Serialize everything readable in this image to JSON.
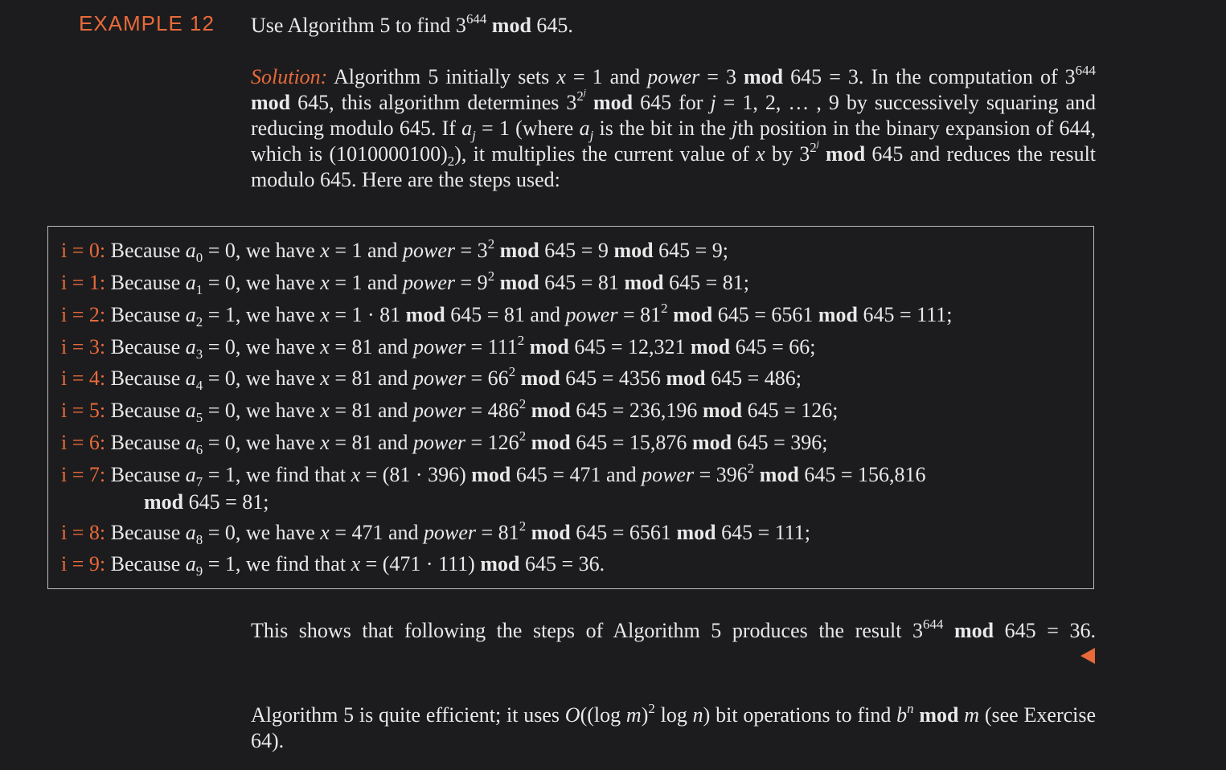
{
  "example": {
    "label": "EXAMPLE 12",
    "statement": {
      "pre": "Use Algorithm 5 to find 3",
      "exp": "644",
      "mod": "mod",
      "post": " 645."
    }
  },
  "solution": {
    "label": "Solution:",
    "t1": " Algorithm 5 initially sets ",
    "x": "x",
    "t2": " = 1 and ",
    "power": "power",
    "t3": " = 3 ",
    "mod": "mod",
    "t4": " 645 = 3. In the computation of 3",
    "exp644": "644",
    "t5": " 645, this algorithm determines 3",
    "exp2j": "2",
    "expj": "j",
    "t6": " 645 for ",
    "j": "j",
    "t7": " = 1, 2, … , 9 by successively squaring and reducing modulo 645. If ",
    "a": "a",
    "t8": " = 1 (where ",
    "t9": " is the bit in the ",
    "t10": "th position in the binary expansion of 644, which is (1010000100)",
    "base": "2",
    "t11": "), it multiplies the current value of ",
    "t12": " by 3",
    "t13": " 645 and reduces the result modulo 645. Here are the steps used:"
  },
  "steps": [
    {
      "idx": "i = 0:",
      "sub": "0",
      "pre": " = 0, we have ",
      "mid": " = 1 and ",
      "pw": " = 3",
      "e": "2",
      "t1": " 645 = 9 ",
      "t2": " 645 = 9;"
    },
    {
      "idx": "i = 1:",
      "sub": "1",
      "pre": " = 0, we have ",
      "mid": " = 1 and ",
      "pw": " = 9",
      "e": "2",
      "t1": " 645 = 81 ",
      "t2": " 645 = 81;"
    },
    {
      "idx": "i = 2:",
      "sub": "2",
      "pre": " = 1, we have ",
      "mid": " = 1 · 81 ",
      "mid2": " 645 = 81 and ",
      "pw": " = 81",
      "e": "2",
      "t1": " 645 = 6561 ",
      "t2": " 645 = 111;"
    },
    {
      "idx": "i = 3:",
      "sub": "3",
      "pre": " = 0, we have ",
      "mid": " = 81 and ",
      "pw": " = 111",
      "e": "2",
      "t1": " 645 = 12,321 ",
      "t2": " 645 = 66;"
    },
    {
      "idx": "i = 4:",
      "sub": "4",
      "pre": " = 0, we have ",
      "mid": " = 81 and ",
      "pw": " = 66",
      "e": "2",
      "t1": " 645 = 4356 ",
      "t2": " 645 = 486;"
    },
    {
      "idx": "i = 5:",
      "sub": "5",
      "pre": " = 0, we have ",
      "mid": " = 81 and ",
      "pw": " = 486",
      "e": "2",
      "t1": " 645 = 236,196 ",
      "t2": " 645 = 126;"
    },
    {
      "idx": "i = 6:",
      "sub": "6",
      "pre": " = 0, we have ",
      "mid": " = 81 and ",
      "pw": " = 126",
      "e": "2",
      "t1": " 645 = 15,876 ",
      "t2": " 645 = 396;"
    },
    {
      "idx": "i = 7:",
      "sub": "7",
      "pre": " = 1, we find that ",
      "mid": " = (81 · 396) ",
      "mid2": " 645 = 471 and ",
      "pw": " = 396",
      "e": "2",
      "t1": " 645 = 156,816",
      "t2": " 645 = 81;"
    },
    {
      "idx": "i = 8:",
      "sub": "8",
      "pre": " = 0, we have ",
      "mid": " = 471 and ",
      "pw": " = 81",
      "e": "2",
      "t1": " 645 = 6561 ",
      "t2": " 645 = 111;"
    },
    {
      "idx": "i = 9:",
      "sub": "9",
      "pre": " = 1, we find that ",
      "mid": " = (471 · 111) ",
      "mid2": " 645 = 36."
    }
  ],
  "common": {
    "because": "Because ",
    "a": "a",
    "x": "x",
    "power": "power",
    "mod": "mod"
  },
  "result": {
    "pre": "This shows that following the steps of Algorithm 5 produces the result 3",
    "exp": "644",
    "mod": "mod",
    "post": " 645 = 36."
  },
  "closing": {
    "t1": "Algorithm 5 is quite efficient; it uses ",
    "O": "O",
    "t2": "((log ",
    "m": "m",
    "t3": ")",
    "exp": "2",
    "t4": " log ",
    "n": "n",
    "t5": ") bit operations to find ",
    "b": "b",
    "expn": "n",
    "mod": "mod",
    "t6": " ",
    "t7": " (see Exercise 64)."
  }
}
